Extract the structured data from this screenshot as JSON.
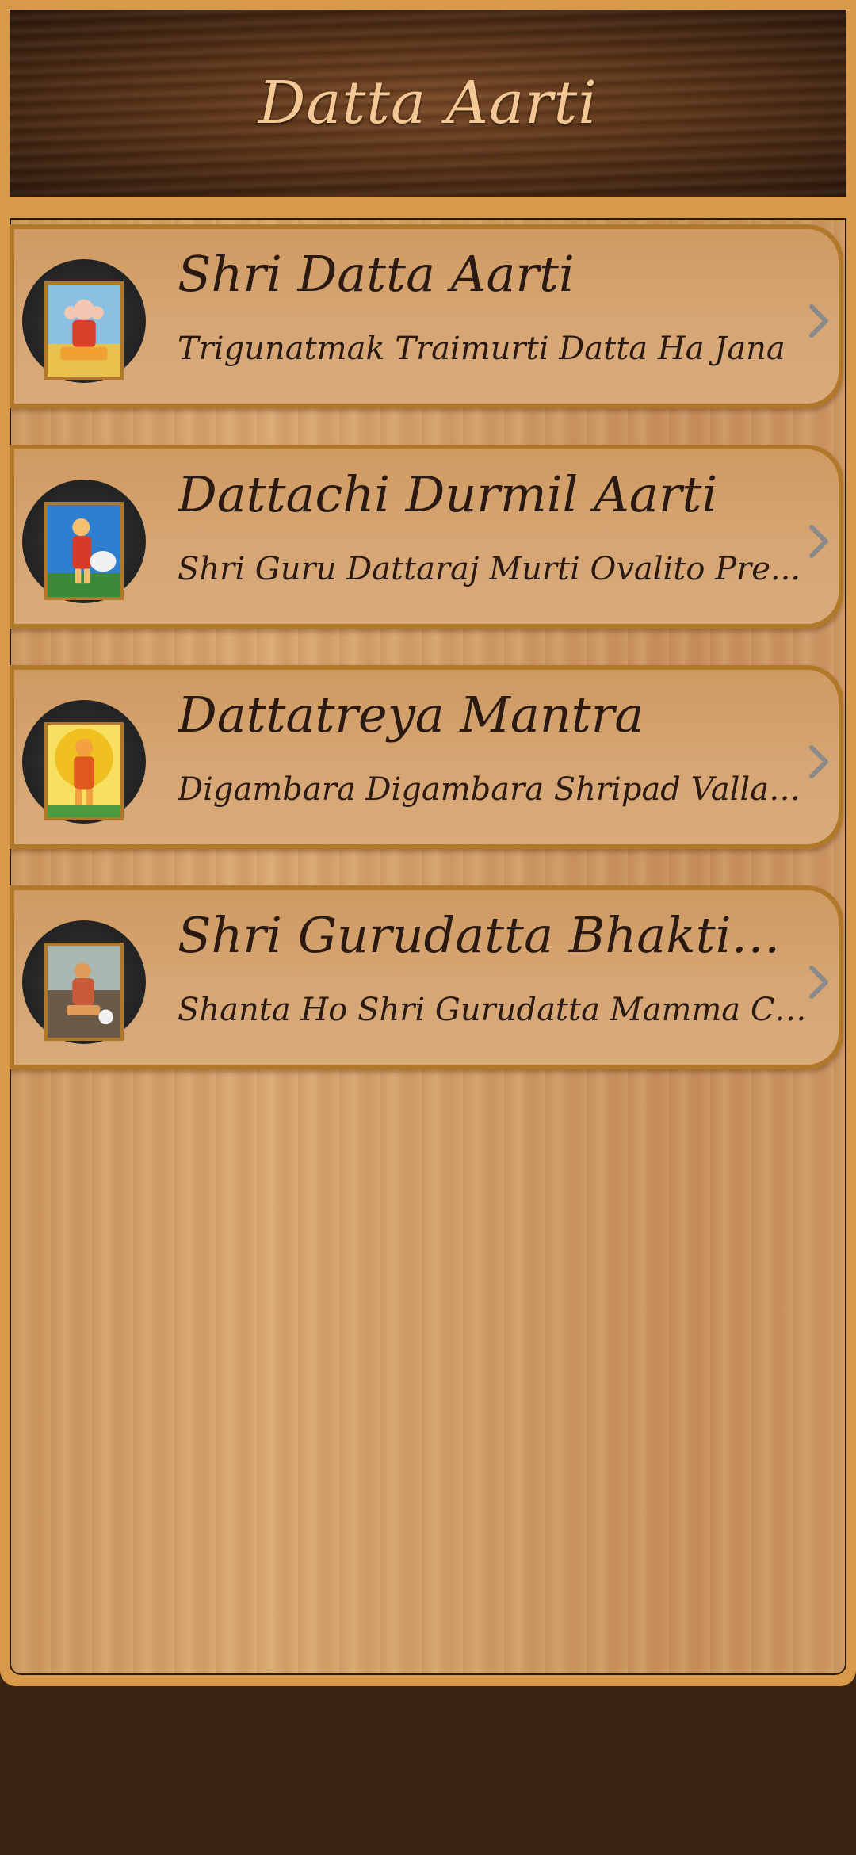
{
  "header": {
    "title": "Datta Aarti"
  },
  "list": {
    "items": [
      {
        "title": "Shri Datta Aarti",
        "subtitle": "Trigunatmak Traimurti Datta Ha Jana",
        "thumb_icon": "deity-picture-icon",
        "thumb_colors": [
          "#e8c24a",
          "#f2c6b0",
          "#d8402a",
          "#8cc0e0"
        ]
      },
      {
        "title": "Dattachi Durmil Aarti",
        "subtitle": "Shri Guru Dattaraj Murti Ovalito Pre...",
        "thumb_icon": "deity-picture-icon",
        "thumb_colors": [
          "#2f7fd0",
          "#f4c070",
          "#d83a2a",
          "#f0f0f0"
        ]
      },
      {
        "title": "Dattatreya Mantra",
        "subtitle": "Digambara Digambara Shripad Vallab...",
        "thumb_icon": "deity-picture-icon",
        "thumb_colors": [
          "#f0c020",
          "#f2a040",
          "#e05a20",
          "#f7e060"
        ]
      },
      {
        "title": "Shri Gurudatta Bhaktigeet",
        "subtitle": "Shanta Ho Shri Gurudatta Mamma Ch...",
        "thumb_icon": "deity-picture-icon",
        "thumb_colors": [
          "#6a5a48",
          "#e09a5a",
          "#c85a3a",
          "#a8b8b0"
        ]
      }
    ]
  },
  "colors": {
    "frame": "#d89a48",
    "item_border": "#b07828",
    "text": "#2a1a12",
    "header_text": "#f4c894"
  }
}
